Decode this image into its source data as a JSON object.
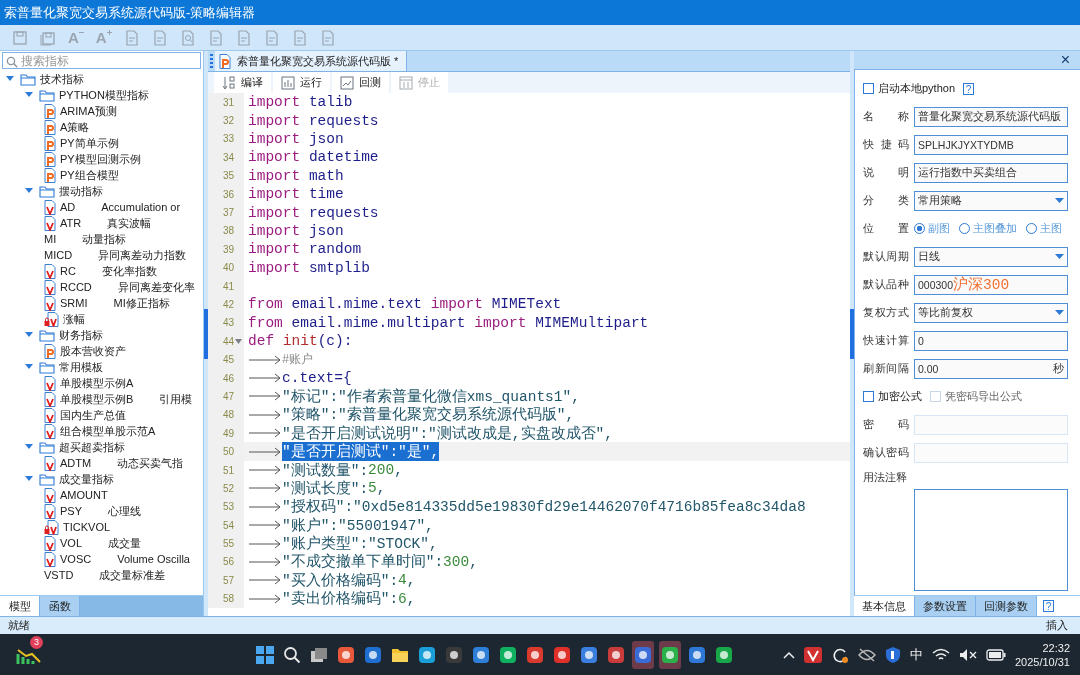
{
  "window": {
    "title": "索普量化聚宽交易系统源代码版-策略编辑器"
  },
  "toolbar": [
    {
      "kind": "save"
    },
    {
      "kind": "save-all"
    },
    {
      "kind": "font-down",
      "text": "A"
    },
    {
      "kind": "font-up",
      "text": "A"
    },
    {
      "kind": "doc"
    },
    {
      "kind": "doc"
    },
    {
      "kind": "find"
    },
    {
      "kind": "doc"
    },
    {
      "kind": "doc"
    },
    {
      "kind": "doc"
    },
    {
      "kind": "doc"
    },
    {
      "kind": "doc"
    }
  ],
  "left_panel": {
    "search": {
      "placeholder": "搜索指标"
    },
    "tree": [
      {
        "label": "技术指标",
        "kind": "folder",
        "expanded": true,
        "children": [
          {
            "label": "PYTHON模型指标",
            "kind": "folder",
            "expanded": true,
            "children": [
              {
                "label": "ARIMA预测",
                "kind": "p"
              },
              {
                "label": "A策略",
                "kind": "p"
              },
              {
                "label": "PY简单示例",
                "kind": "p"
              },
              {
                "label": "PY模型回测示例",
                "kind": "p"
              },
              {
                "label": "PY组合模型",
                "kind": "p"
              }
            ]
          },
          {
            "label": "摆动指标",
            "kind": "folder",
            "expanded": true,
            "children": [
              {
                "label": "AD",
                "desc": "Accumulation or",
                "kind": "v"
              },
              {
                "label": "ATR",
                "desc": "真实波幅",
                "kind": "v"
              },
              {
                "label": "MI",
                "desc": "动量指标",
                "kind": "plain"
              },
              {
                "label": "MICD",
                "desc": "异同离差动力指数",
                "kind": "plain"
              },
              {
                "label": "RC",
                "desc": "变化率指数",
                "kind": "v"
              },
              {
                "label": "RCCD",
                "desc": "异同离差变化率",
                "kind": "v"
              },
              {
                "label": "SRMI",
                "desc": "MI修正指标",
                "kind": "v"
              },
              {
                "label": "涨幅",
                "kind": "lock"
              }
            ]
          },
          {
            "label": "财务指标",
            "kind": "folder",
            "expanded": true,
            "children": [
              {
                "label": "股本营收资产",
                "kind": "p"
              }
            ]
          },
          {
            "label": "常用模板",
            "kind": "folder",
            "expanded": true,
            "children": [
              {
                "label": "单股模型示例A",
                "kind": "v"
              },
              {
                "label": "单股模型示例B",
                "desc": "引用模",
                "kind": "v"
              },
              {
                "label": "国内生产总值",
                "kind": "v"
              },
              {
                "label": "组合模型单股示范A",
                "kind": "v"
              }
            ]
          },
          {
            "label": "超买超卖指标",
            "kind": "folder",
            "expanded": true,
            "children": [
              {
                "label": "ADTM",
                "desc": "动态买卖气指",
                "kind": "v"
              }
            ]
          },
          {
            "label": "成交量指标",
            "kind": "folder",
            "expanded": true,
            "children": [
              {
                "label": "AMOUNT",
                "kind": "v"
              },
              {
                "label": "PSY",
                "desc": "心理线",
                "kind": "v"
              },
              {
                "label": "TICKVOL",
                "kind": "lock"
              },
              {
                "label": "VOL",
                "desc": "成交量",
                "kind": "v"
              },
              {
                "label": "VOSC",
                "desc": "Volume Oscilla",
                "kind": "v"
              },
              {
                "label": "VSTD",
                "desc": "成交量标准差",
                "kind": "plain"
              }
            ]
          }
        ]
      }
    ],
    "tabs": [
      {
        "label": "模型",
        "selected": true
      },
      {
        "label": "函数",
        "selected": false
      }
    ]
  },
  "editor": {
    "tab": {
      "title": "索普量化聚宽交易系统源代码版 *"
    },
    "tools": [
      {
        "kind": "compile",
        "label": "编译",
        "disabled": false
      },
      {
        "kind": "run",
        "label": "运行",
        "disabled": false
      },
      {
        "kind": "backtest",
        "label": "回测",
        "disabled": false
      },
      {
        "kind": "stop",
        "label": "停止",
        "disabled": true
      }
    ],
    "lines": [
      {
        "n": "31",
        "selected": false,
        "tokens": [
          {
            "kind": "kw",
            "text": "import"
          },
          {
            "kind": "name",
            "text": " talib"
          }
        ]
      },
      {
        "n": "32",
        "selected": false,
        "tokens": [
          {
            "kind": "kw",
            "text": "import"
          },
          {
            "kind": "name",
            "text": " requests"
          }
        ]
      },
      {
        "n": "33",
        "selected": false,
        "tokens": [
          {
            "kind": "kw",
            "text": "import"
          },
          {
            "kind": "name",
            "text": " json"
          }
        ]
      },
      {
        "n": "34",
        "selected": false,
        "tokens": [
          {
            "kind": "kw",
            "text": "import"
          },
          {
            "kind": "name",
            "text": " datetime"
          }
        ]
      },
      {
        "n": "35",
        "selected": false,
        "tokens": [
          {
            "kind": "kw",
            "text": "import"
          },
          {
            "kind": "name",
            "text": " math"
          }
        ]
      },
      {
        "n": "36",
        "selected": false,
        "tokens": [
          {
            "kind": "kw",
            "text": "import"
          },
          {
            "kind": "name",
            "text": " time"
          }
        ]
      },
      {
        "n": "37",
        "selected": false,
        "tokens": [
          {
            "kind": "kw",
            "text": "import"
          },
          {
            "kind": "name",
            "text": " requests"
          }
        ]
      },
      {
        "n": "38",
        "selected": false,
        "tokens": [
          {
            "kind": "kw",
            "text": "import"
          },
          {
            "kind": "name",
            "text": " json"
          }
        ]
      },
      {
        "n": "39",
        "selected": false,
        "tokens": [
          {
            "kind": "kw",
            "text": "import"
          },
          {
            "kind": "name",
            "text": " random"
          }
        ]
      },
      {
        "n": "40",
        "selected": false,
        "tokens": [
          {
            "kind": "kw",
            "text": "import"
          },
          {
            "kind": "name",
            "text": " smtplib"
          }
        ]
      },
      {
        "n": "41",
        "selected": false
      },
      {
        "n": "42",
        "selected": false,
        "tokens": [
          {
            "kind": "kw",
            "text": "from"
          },
          {
            "kind": "name",
            "text": " email.mime.text "
          },
          {
            "kind": "kw",
            "text": "import"
          },
          {
            "kind": "name",
            "text": " MIMEText"
          }
        ]
      },
      {
        "n": "43",
        "selected": false,
        "tokens": [
          {
            "kind": "kw",
            "text": "from"
          },
          {
            "kind": "name",
            "text": " email.mime.multipart "
          },
          {
            "kind": "kw",
            "text": "import"
          },
          {
            "kind": "name",
            "text": " MIMEMultipart"
          }
        ]
      },
      {
        "n": "44",
        "selected": false,
        "fold": true,
        "tokens": [
          {
            "kind": "kw",
            "text": "def"
          },
          {
            "kind": "fn",
            "text": " init"
          },
          {
            "kind": "name",
            "text": "(c):"
          }
        ]
      },
      {
        "n": "45",
        "selected": false,
        "indented": true,
        "tokens": [
          {
            "kind": "comment",
            "text": "#账户"
          }
        ]
      },
      {
        "n": "46",
        "selected": false,
        "indented": true,
        "tokens": [
          {
            "kind": "name",
            "text": "c.text={"
          }
        ]
      },
      {
        "n": "47",
        "selected": false,
        "indented": true,
        "tokens": [
          {
            "kind": "str",
            "text": "\"标记\":\"作者索普量化微信xms_quants1\","
          }
        ]
      },
      {
        "n": "48",
        "selected": false,
        "indented": true,
        "tokens": [
          {
            "kind": "str",
            "text": "\"策略\":\"索普量化聚宽交易系统源代码版\","
          }
        ]
      },
      {
        "n": "49",
        "selected": false,
        "indented": true,
        "tokens": [
          {
            "kind": "str",
            "text": "\"是否开启测试说明\":\"测试改成是,实盘改成否\","
          }
        ]
      },
      {
        "n": "50",
        "selected": true,
        "indented": true,
        "tokens": [
          {
            "kind": "selection",
            "text": "\"是否开启测试\":\"是\","
          }
        ]
      },
      {
        "n": "51",
        "selected": false,
        "indented": true,
        "tokens": [
          {
            "kind": "str",
            "text": "\"测试数量\":"
          },
          {
            "kind": "num",
            "text": "200"
          },
          {
            "kind": "str",
            "text": ","
          }
        ]
      },
      {
        "n": "52",
        "selected": false,
        "indented": true,
        "tokens": [
          {
            "kind": "str",
            "text": "\"测试长度\":"
          },
          {
            "kind": "num",
            "text": "5"
          },
          {
            "kind": "str",
            "text": ","
          }
        ]
      },
      {
        "n": "53",
        "selected": false,
        "indented": true,
        "tokens": [
          {
            "kind": "str",
            "text": "\"授权码\":\"0xd5e814335dd5e19830fd29e14462070f4716b85fea8c34da8"
          }
        ]
      },
      {
        "n": "54",
        "selected": false,
        "indented": true,
        "tokens": [
          {
            "kind": "str",
            "text": "\"账户\":\"55001947\","
          }
        ]
      },
      {
        "n": "55",
        "selected": false,
        "indented": true,
        "tokens": [
          {
            "kind": "str",
            "text": "\"账户类型\":\"STOCK\","
          }
        ]
      },
      {
        "n": "56",
        "selected": false,
        "indented": true,
        "tokens": [
          {
            "kind": "str",
            "text": "\"不成交撤单下单时间\":"
          },
          {
            "kind": "num",
            "text": "300"
          },
          {
            "kind": "str",
            "text": ","
          }
        ]
      },
      {
        "n": "57",
        "selected": false,
        "indented": true,
        "tokens": [
          {
            "kind": "str",
            "text": "\"买入价格编码\":"
          },
          {
            "kind": "num",
            "text": "4"
          },
          {
            "kind": "str",
            "text": ","
          }
        ]
      },
      {
        "n": "58",
        "selected": false,
        "indented": true,
        "tokens": [
          {
            "kind": "str",
            "text": "\"卖出价格编码\":"
          },
          {
            "kind": "num",
            "text": "6"
          },
          {
            "kind": "str",
            "text": ","
          }
        ]
      }
    ]
  },
  "right_panel": {
    "close": "×",
    "local_python": {
      "label": "启动本地python",
      "checked": false,
      "help": "?"
    },
    "fields": [
      {
        "kind": "text",
        "label": "名称",
        "value": "普量化聚宽交易系统源代码版"
      },
      {
        "kind": "text",
        "label": "快捷码",
        "value": "SPLHJKJYXTYDMB"
      },
      {
        "kind": "text",
        "label": "说明",
        "value": "运行指数中买卖组合"
      },
      {
        "kind": "select",
        "label": "分类",
        "value": "常用策略"
      },
      {
        "kind": "radio",
        "label": "位置",
        "options": [
          {
            "label": "副图",
            "selected": true
          },
          {
            "label": "主图叠加",
            "selected": false
          },
          {
            "label": "主图",
            "selected": false
          }
        ]
      },
      {
        "kind": "select",
        "label": "默认周期",
        "value": "日线"
      },
      {
        "kind": "code",
        "label": "默认品种",
        "value": "000300",
        "suffix": "沪深300"
      },
      {
        "kind": "select",
        "label": "复权方式",
        "value": "等比前复权"
      },
      {
        "kind": "text",
        "label": "快速计算",
        "value": "0"
      },
      {
        "kind": "unit",
        "label": "刷新间隔",
        "value": "0.00",
        "suffix": "秒"
      },
      {
        "kind": "checks",
        "options": [
          {
            "label": "加密公式",
            "checked": false,
            "disabled": false
          },
          {
            "label": "凭密码导出公式",
            "checked": false,
            "disabled": true
          }
        ]
      },
      {
        "kind": "password",
        "label": "密码",
        "disabled": true
      },
      {
        "kind": "password",
        "label": "确认密码",
        "disabled": true
      },
      {
        "kind": "textarea",
        "label": "用法注释"
      }
    ],
    "tabs": [
      {
        "label": "基本信息",
        "selected": true
      },
      {
        "label": "参数设置",
        "selected": false
      },
      {
        "label": "回测参数",
        "selected": false
      }
    ],
    "help": "?"
  },
  "status_bar": {
    "left": "就绪",
    "right": "插入"
  },
  "taskbar": {
    "badge": "3",
    "apps": [
      {
        "kind": "start",
        "active": false
      },
      {
        "kind": "search",
        "active": false
      },
      {
        "kind": "taskview",
        "active": false
      },
      {
        "kind": "app",
        "color": "#e8583a",
        "active": false
      },
      {
        "kind": "app",
        "color": "#1f6fd0",
        "active": false
      },
      {
        "kind": "folder",
        "active": false
      },
      {
        "kind": "app",
        "color": "#1a9fd8",
        "active": false
      },
      {
        "kind": "app",
        "color": "#3a3a3a",
        "active": false
      },
      {
        "kind": "app",
        "color": "#2d7fd8",
        "active": false
      },
      {
        "kind": "app",
        "color": "#0fb060",
        "active": false
      },
      {
        "kind": "app",
        "color": "#d83a2e",
        "active": false
      },
      {
        "kind": "app",
        "color": "#e0302a",
        "active": false
      },
      {
        "kind": "app",
        "color": "#3a7ee0",
        "active": false
      },
      {
        "kind": "app",
        "color": "#c93c3c",
        "active": false
      },
      {
        "kind": "app",
        "color": "#3a6cd8",
        "active": true
      },
      {
        "kind": "app",
        "color": "#2bb14a",
        "active": true
      },
      {
        "kind": "app",
        "color": "#2f78d8",
        "active": false
      },
      {
        "kind": "app",
        "color": "#18a84a",
        "active": false
      }
    ],
    "ime": "中",
    "time": "22:32",
    "date": "2025/10/31"
  }
}
